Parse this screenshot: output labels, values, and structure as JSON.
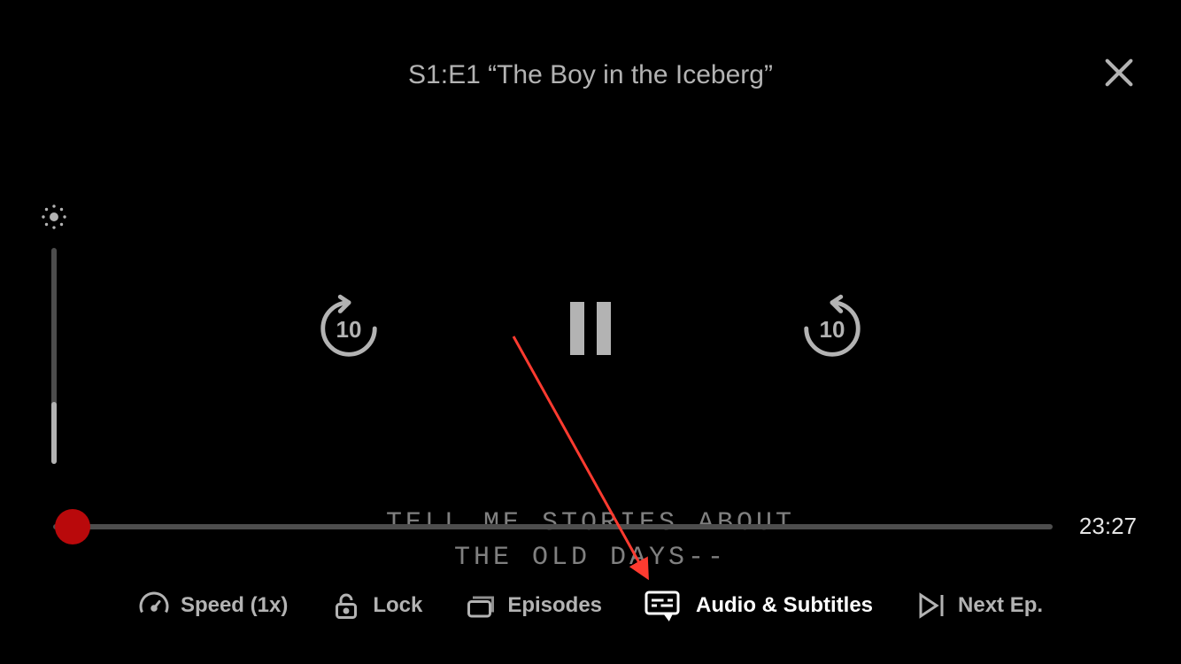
{
  "title": "S1:E1 “The Boy in the Iceberg”",
  "seek": {
    "back_label": "10",
    "forward_label": "10"
  },
  "subtitle_overlay": "TELL ME STORIES ABOUT\nTHE OLD DAYS--",
  "time_remaining": "23:27",
  "bottom": {
    "speed": "Speed (1x)",
    "lock": "Lock",
    "episodes": "Episodes",
    "audio_subtitles": "Audio & Subtitles",
    "next_ep": "Next Ep."
  }
}
